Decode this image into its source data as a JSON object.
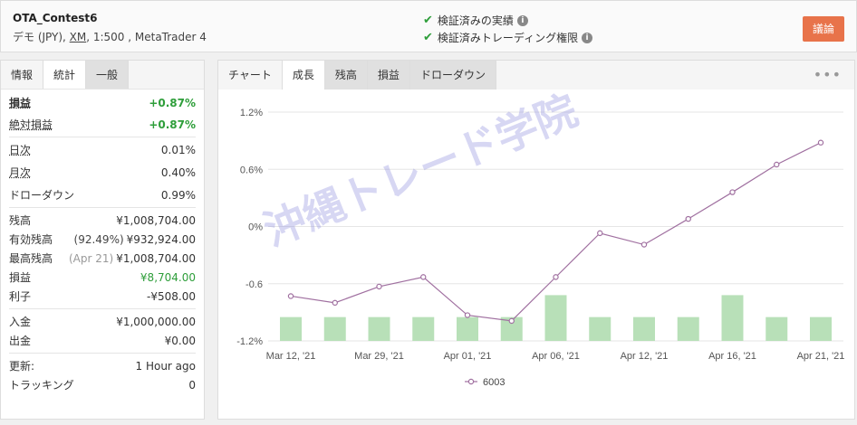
{
  "header": {
    "account_name": "OTA_Contest6",
    "account_type": "デモ (JPY), ",
    "broker": "XM",
    "leverage_platform": ", 1:500 , MetaTrader 4",
    "verified_track": "検証済みの実績",
    "verified_trading": "検証済みトレーディング権限",
    "discuss_button": "議論"
  },
  "left_tabs": [
    "情報",
    "統計",
    "一般"
  ],
  "stats": {
    "group1": [
      {
        "label": "損益",
        "value": "+0.87%"
      },
      {
        "label": "絶対損益",
        "value": "+0.87%"
      }
    ],
    "group2": [
      {
        "label": "日次",
        "value": "0.01%"
      },
      {
        "label": "月次",
        "value": "0.40%"
      },
      {
        "label": "ドローダウン",
        "value": "0.99%"
      }
    ],
    "group3": [
      {
        "label": "残高",
        "value": "¥1,008,704.00"
      },
      {
        "label": "有効残高",
        "paren": "(92.49%)",
        "value": "¥932,924.00"
      },
      {
        "label": "最高残高",
        "paren": "(Apr 21)",
        "value": "¥1,008,704.00"
      },
      {
        "label": "損益",
        "value": "¥8,704.00"
      },
      {
        "label": "利子",
        "value": "-¥508.00"
      }
    ],
    "group4": [
      {
        "label": "入金",
        "value": "¥1,000,000.00"
      },
      {
        "label": "出金",
        "value": "¥0.00"
      }
    ],
    "group5": [
      {
        "label": "更新:",
        "value": "1 Hour ago"
      },
      {
        "label": "トラッキング",
        "value": "0"
      }
    ]
  },
  "right_tabs": [
    "チャート",
    "成長",
    "残高",
    "損益",
    "ドローダウン"
  ],
  "menu_glyph": "•••",
  "watermark": "沖縄トレード学院",
  "chart_data": {
    "type": "line",
    "y_ticks": [
      "1.2%",
      "0.6%",
      "0%",
      "-0.6",
      "-1.2%"
    ],
    "ylim": [
      -1.2,
      1.2
    ],
    "x_tick_labels": [
      "Mar 12, '21",
      "Mar 29, '21",
      "Apr 01, '21",
      "Apr 06, '21",
      "Apr 12, '21",
      "Apr 16, '21",
      "Apr 21, '21"
    ],
    "series": [
      {
        "name": "6003",
        "color": "#a070a0",
        "values": [
          -0.73,
          -0.8,
          -0.63,
          -0.53,
          -0.93,
          -0.99,
          -0.53,
          -0.07,
          -0.19,
          0.08,
          0.36,
          0.65,
          0.88
        ]
      }
    ],
    "bars": {
      "color": "#b8e0b8",
      "values": [
        -0.95,
        -0.95,
        -0.95,
        -0.95,
        -0.95,
        -0.95,
        -0.72,
        -0.95,
        -0.95,
        -0.95,
        -0.72,
        -0.95,
        -0.95
      ]
    },
    "legend": "6003"
  },
  "colors": {
    "accent": "#e8734a",
    "green": "#2e9e3a",
    "line": "#a070a0",
    "bar": "#b8e0b8"
  }
}
